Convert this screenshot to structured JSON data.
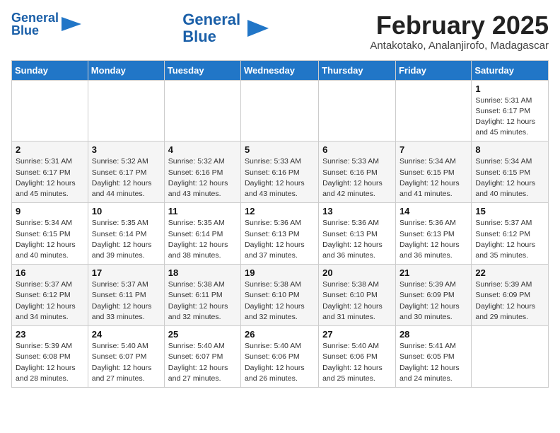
{
  "header": {
    "logo_general": "General",
    "logo_blue": "Blue",
    "month": "February 2025",
    "location": "Antakotako, Analanjirofo, Madagascar"
  },
  "weekdays": [
    "Sunday",
    "Monday",
    "Tuesday",
    "Wednesday",
    "Thursday",
    "Friday",
    "Saturday"
  ],
  "weeks": [
    [
      {
        "day": "",
        "info": ""
      },
      {
        "day": "",
        "info": ""
      },
      {
        "day": "",
        "info": ""
      },
      {
        "day": "",
        "info": ""
      },
      {
        "day": "",
        "info": ""
      },
      {
        "day": "",
        "info": ""
      },
      {
        "day": "1",
        "info": "Sunrise: 5:31 AM\nSunset: 6:17 PM\nDaylight: 12 hours\nand 45 minutes."
      }
    ],
    [
      {
        "day": "2",
        "info": "Sunrise: 5:31 AM\nSunset: 6:17 PM\nDaylight: 12 hours\nand 45 minutes."
      },
      {
        "day": "3",
        "info": "Sunrise: 5:32 AM\nSunset: 6:17 PM\nDaylight: 12 hours\nand 44 minutes."
      },
      {
        "day": "4",
        "info": "Sunrise: 5:32 AM\nSunset: 6:16 PM\nDaylight: 12 hours\nand 43 minutes."
      },
      {
        "day": "5",
        "info": "Sunrise: 5:33 AM\nSunset: 6:16 PM\nDaylight: 12 hours\nand 43 minutes."
      },
      {
        "day": "6",
        "info": "Sunrise: 5:33 AM\nSunset: 6:16 PM\nDaylight: 12 hours\nand 42 minutes."
      },
      {
        "day": "7",
        "info": "Sunrise: 5:34 AM\nSunset: 6:15 PM\nDaylight: 12 hours\nand 41 minutes."
      },
      {
        "day": "8",
        "info": "Sunrise: 5:34 AM\nSunset: 6:15 PM\nDaylight: 12 hours\nand 40 minutes."
      }
    ],
    [
      {
        "day": "9",
        "info": "Sunrise: 5:34 AM\nSunset: 6:15 PM\nDaylight: 12 hours\nand 40 minutes."
      },
      {
        "day": "10",
        "info": "Sunrise: 5:35 AM\nSunset: 6:14 PM\nDaylight: 12 hours\nand 39 minutes."
      },
      {
        "day": "11",
        "info": "Sunrise: 5:35 AM\nSunset: 6:14 PM\nDaylight: 12 hours\nand 38 minutes."
      },
      {
        "day": "12",
        "info": "Sunrise: 5:36 AM\nSunset: 6:13 PM\nDaylight: 12 hours\nand 37 minutes."
      },
      {
        "day": "13",
        "info": "Sunrise: 5:36 AM\nSunset: 6:13 PM\nDaylight: 12 hours\nand 36 minutes."
      },
      {
        "day": "14",
        "info": "Sunrise: 5:36 AM\nSunset: 6:13 PM\nDaylight: 12 hours\nand 36 minutes."
      },
      {
        "day": "15",
        "info": "Sunrise: 5:37 AM\nSunset: 6:12 PM\nDaylight: 12 hours\nand 35 minutes."
      }
    ],
    [
      {
        "day": "16",
        "info": "Sunrise: 5:37 AM\nSunset: 6:12 PM\nDaylight: 12 hours\nand 34 minutes."
      },
      {
        "day": "17",
        "info": "Sunrise: 5:37 AM\nSunset: 6:11 PM\nDaylight: 12 hours\nand 33 minutes."
      },
      {
        "day": "18",
        "info": "Sunrise: 5:38 AM\nSunset: 6:11 PM\nDaylight: 12 hours\nand 32 minutes."
      },
      {
        "day": "19",
        "info": "Sunrise: 5:38 AM\nSunset: 6:10 PM\nDaylight: 12 hours\nand 32 minutes."
      },
      {
        "day": "20",
        "info": "Sunrise: 5:38 AM\nSunset: 6:10 PM\nDaylight: 12 hours\nand 31 minutes."
      },
      {
        "day": "21",
        "info": "Sunrise: 5:39 AM\nSunset: 6:09 PM\nDaylight: 12 hours\nand 30 minutes."
      },
      {
        "day": "22",
        "info": "Sunrise: 5:39 AM\nSunset: 6:09 PM\nDaylight: 12 hours\nand 29 minutes."
      }
    ],
    [
      {
        "day": "23",
        "info": "Sunrise: 5:39 AM\nSunset: 6:08 PM\nDaylight: 12 hours\nand 28 minutes."
      },
      {
        "day": "24",
        "info": "Sunrise: 5:40 AM\nSunset: 6:07 PM\nDaylight: 12 hours\nand 27 minutes."
      },
      {
        "day": "25",
        "info": "Sunrise: 5:40 AM\nSunset: 6:07 PM\nDaylight: 12 hours\nand 27 minutes."
      },
      {
        "day": "26",
        "info": "Sunrise: 5:40 AM\nSunset: 6:06 PM\nDaylight: 12 hours\nand 26 minutes."
      },
      {
        "day": "27",
        "info": "Sunrise: 5:40 AM\nSunset: 6:06 PM\nDaylight: 12 hours\nand 25 minutes."
      },
      {
        "day": "28",
        "info": "Sunrise: 5:41 AM\nSunset: 6:05 PM\nDaylight: 12 hours\nand 24 minutes."
      },
      {
        "day": "",
        "info": ""
      }
    ]
  ]
}
